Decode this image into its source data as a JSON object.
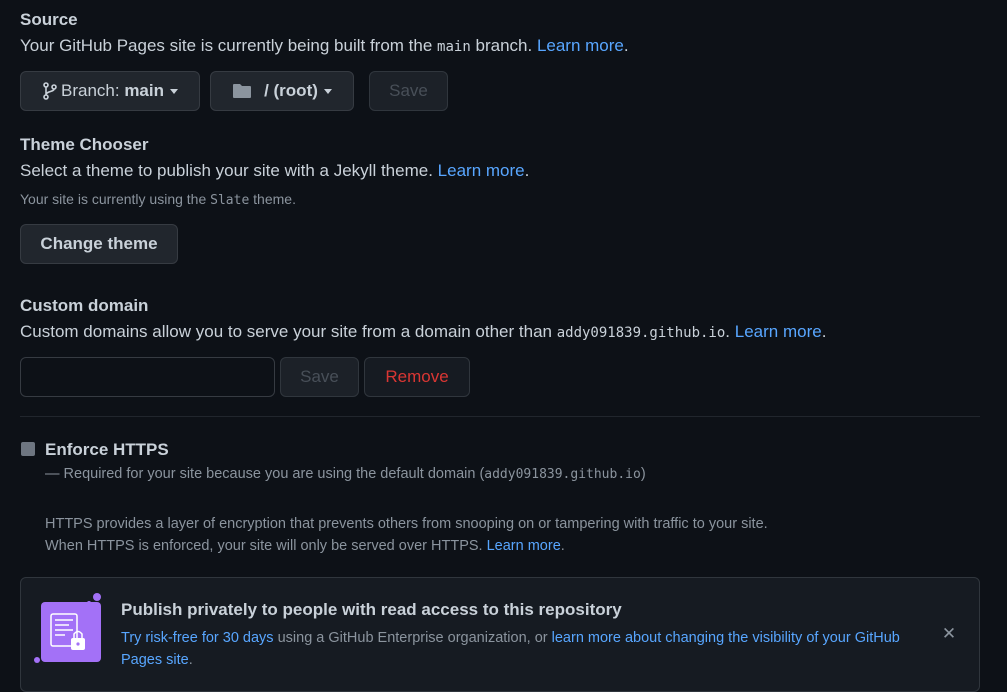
{
  "source": {
    "title": "Source",
    "desc_before": "Your GitHub Pages site is currently being built from the",
    "desc_branch_code": "main",
    "desc_after": "branch.",
    "learn_more": "Learn more",
    "period": ".",
    "branch_prefix": "Branch:",
    "branch_value": "main",
    "folder_value": "/ (root)",
    "save_label": "Save"
  },
  "theme": {
    "title": "Theme Chooser",
    "desc": "Select a theme to publish your site with a Jekyll theme.",
    "learn_more": "Learn more",
    "period": ".",
    "note_before": "Your site is currently using the",
    "note_theme": "Slate",
    "note_after": "theme.",
    "change_label": "Change theme"
  },
  "custom_domain": {
    "title": "Custom domain",
    "desc": "Custom domains allow you to serve your site from a domain other than",
    "domain_code": "addy091839.github.io",
    "period_after_code": ".",
    "learn_more": "Learn more",
    "period": ".",
    "input_value": "",
    "input_placeholder": "",
    "save_label": "Save",
    "remove_label": "Remove"
  },
  "https": {
    "title": "Enforce HTTPS",
    "checked": false,
    "required_before": "— Required for your site because you are using the default domain (",
    "required_code": "addy091839.github.io",
    "required_after": ")",
    "info_line1": "HTTPS provides a layer of encryption that prevents others from snooping on or tampering with traffic to your site.",
    "info_line2": "When HTTPS is enforced, your site will only be served over HTTPS.",
    "learn_more": "Learn more",
    "period": "."
  },
  "banner": {
    "title": "Publish privately to people with read access to this repository",
    "try_link": "Try risk-free for 30 days",
    "middle_text": "using a GitHub Enterprise organization, or",
    "learn_link_1": "learn more about changing the visibility of your GitHub",
    "learn_link_2": "Pages site",
    "period": ".",
    "close_glyph": "✕"
  },
  "colors": {
    "background": "#0d1117",
    "link": "#58a6ff",
    "danger": "#da3633",
    "banner_icon_bg": "#a371f7"
  }
}
